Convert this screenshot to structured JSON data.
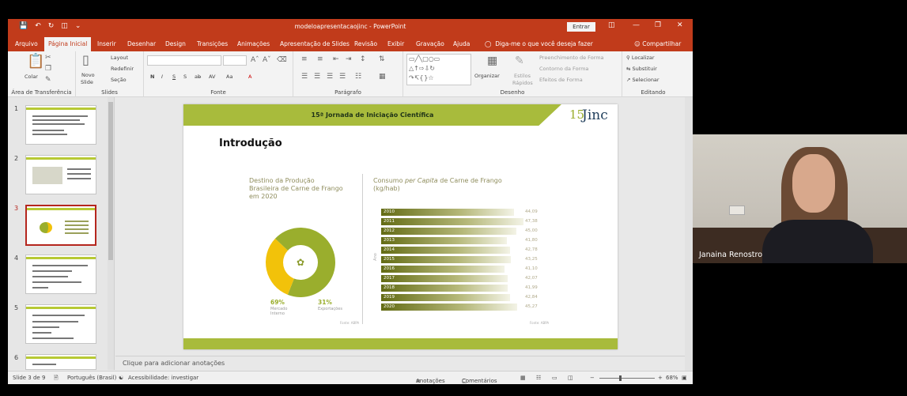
{
  "window": {
    "title": "modeloapresentacaojinc - PowerPoint",
    "signin": "Entrar"
  },
  "tabs": [
    "Arquivo",
    "Página Inicial",
    "Inserir",
    "Desenhar",
    "Design",
    "Transições",
    "Animações",
    "Apresentação de Slides",
    "Revisão",
    "Exibir",
    "Gravação",
    "Ajuda"
  ],
  "active_tab": "Página Inicial",
  "tell_me": "Diga-me o que você deseja fazer",
  "share": "Compartilhar",
  "ribbon": {
    "clipboard": {
      "label": "Área de Transferência",
      "paste": "Colar"
    },
    "slides": {
      "label": "Slides",
      "new_slide": "Novo",
      "new_slide2": "Slide",
      "layout": "Layout",
      "reset": "Redefinir",
      "section": "Seção"
    },
    "font": {
      "label": "Fonte",
      "bold": "N",
      "italic": "I",
      "underline": "S",
      "strike": "S",
      "spacing": "AV",
      "case": "Aa",
      "color": "A"
    },
    "paragraph": {
      "label": "Parágrafo"
    },
    "drawing": {
      "label": "Desenho",
      "arrange": "Organizar",
      "styles": "Estilos",
      "quick": "Rápidos",
      "fill": "Preenchimento de Forma",
      "outline": "Contorno da Forma",
      "effects": "Efeitos de Forma"
    },
    "editing": {
      "label": "Editando",
      "find": "Localizar",
      "replace": "Substituir",
      "select": "Selecionar"
    }
  },
  "thumbnails": [
    {
      "num": "1"
    },
    {
      "num": "2"
    },
    {
      "num": "3"
    },
    {
      "num": "4"
    },
    {
      "num": "5"
    },
    {
      "num": "6"
    }
  ],
  "slide": {
    "header": "15ª Jornada de Iniciação Científica",
    "logo_num": "15",
    "logo_word": "Jinc",
    "title": "Introdução",
    "left_title": "Destino da Produção Brasileira de Carne de Frango em 2020",
    "right_title_pre": "Consumo ",
    "right_title_em": "per Capita",
    "right_title_post": " de Carne de Frango",
    "right_unit": "(kg/hab)",
    "pct_internal": "69%",
    "pct_internal_label": "Mercado Interno",
    "pct_export": "31%",
    "pct_export_label": "Exportações",
    "source_left": "Fonte: ABPA",
    "source_right": "Fonte: ABPA",
    "axis": "Ano"
  },
  "chart_data": [
    {
      "type": "pie",
      "title": "Destino da Produção Brasileira de Carne de Frango em 2020",
      "categories": [
        "Mercado Interno",
        "Exportações"
      ],
      "values": [
        69,
        31
      ],
      "colors": [
        "#9aae2d",
        "#f2c20a"
      ]
    },
    {
      "type": "bar",
      "title": "Consumo per Capita de Carne de Frango",
      "ylabel": "Ano",
      "xlabel": "(kg/hab)",
      "categories": [
        "2010",
        "2011",
        "2012",
        "2013",
        "2014",
        "2015",
        "2016",
        "2017",
        "2018",
        "2019",
        "2020"
      ],
      "values": [
        44.09,
        47.38,
        45.0,
        41.8,
        42.78,
        43.25,
        41.1,
        42.07,
        41.99,
        42.84,
        45.27
      ],
      "value_labels": [
        "44,09",
        "47,38",
        "45,00",
        "41,80",
        "42,78",
        "43,25",
        "41,10",
        "42,07",
        "41,99",
        "42,84",
        "45,27"
      ]
    }
  ],
  "notes_placeholder": "Clique para adicionar anotações",
  "status": {
    "slide": "Slide 3 de 9",
    "language": "Português (Brasil)",
    "accessibility": "Acessibilidade: investigar",
    "notes": "Anotações",
    "comments": "Comentários",
    "zoom": "68%"
  },
  "video": {
    "name": "Janaina Renostro"
  }
}
